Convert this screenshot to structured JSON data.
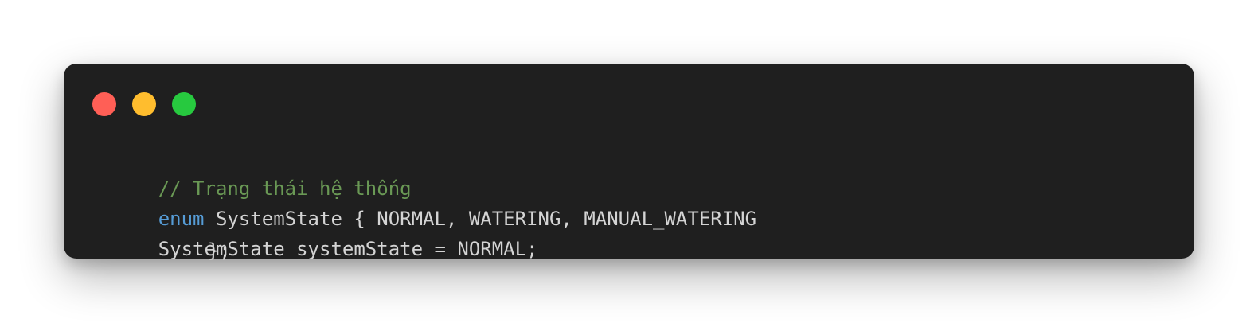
{
  "window": {
    "controls": [
      {
        "name": "close",
        "color": "#ff5f56"
      },
      {
        "name": "minimize",
        "color": "#ffbd2e"
      },
      {
        "name": "maximize",
        "color": "#27c93f"
      }
    ],
    "background_color": "#1f1f1f"
  },
  "code": {
    "comment": "// Trạng thái hệ thống",
    "enum_keyword": "enum",
    "enum_rest": " SystemState { NORMAL, WATERING, MANUAL_WATERING",
    "line3": "SystemState systemState = NORMAL;",
    "closing": "};",
    "colors": {
      "comment": "#6a9955",
      "keyword": "#569cd6",
      "text": "#d4d4d4"
    }
  }
}
